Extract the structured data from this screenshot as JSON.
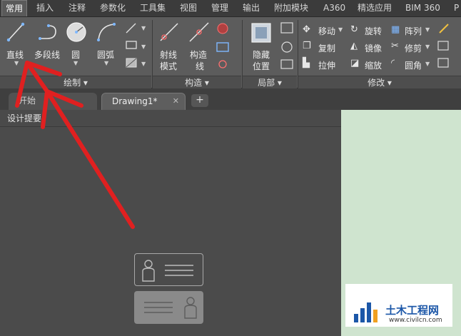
{
  "ribbon_tabs": [
    "常用",
    "插入",
    "注释",
    "参数化",
    "工具集",
    "视图",
    "管理",
    "输出",
    "附加模块",
    "A360",
    "精选应用",
    "BIM 360",
    "P"
  ],
  "draw_panel": {
    "title": "绘制",
    "line": "直线",
    "polyline": "多段线",
    "circle": "圆",
    "arc": "圆弧"
  },
  "construct_panel": {
    "title": "构造",
    "ray_line1": "射线",
    "ray_line2": "模式",
    "xline_line1": "构造",
    "xline_line2": "线"
  },
  "local_panel": {
    "title": "局部",
    "hide_line1": "隐藏",
    "hide_line2": "位置"
  },
  "modify_panel": {
    "title": "修改",
    "move": "移动",
    "rotate": "旋转",
    "array": "阵列",
    "copy": "复制",
    "mirror": "镜像",
    "trim": "修剪",
    "stretch": "拉伸",
    "scale": "缩放",
    "fillet": "圆角"
  },
  "doc_tabs": {
    "start": "开始",
    "drawing": "Drawing1*",
    "new_tab": "+"
  },
  "design_panel_title": "设计提要",
  "watermark": {
    "title": "土木工程网",
    "url": "www.civilcn.com"
  },
  "colors": {
    "ribbon_bg": "#5c5c5c",
    "canvas_bg": "#cfe4cf",
    "arrow_red": "#e02020",
    "watermark_blue": "#1c57a8"
  }
}
